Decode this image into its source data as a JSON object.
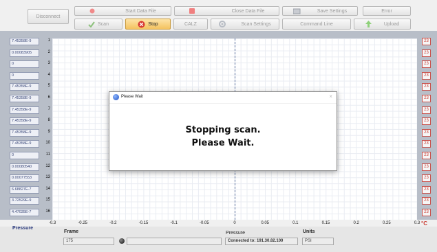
{
  "toolbar": {
    "disconnect": "Disconnect",
    "start_data_file": "Start Data File",
    "close_data_file": "Close Data File",
    "save_settings": "Save Settings",
    "error": "Error",
    "scan": "Scan",
    "stop": "Stop",
    "calz": "CALZ",
    "scan_settings": "Scan Settings",
    "command_line": "Command Line",
    "upload": "Upload"
  },
  "channels": [
    {
      "num": "1",
      "value": "7.45358E-9"
    },
    {
      "num": "2",
      "value": "0.00083905"
    },
    {
      "num": "3",
      "value": "0"
    },
    {
      "num": "4",
      "value": "0"
    },
    {
      "num": "5",
      "value": "7.45358E-9"
    },
    {
      "num": "6",
      "value": "7.45358E-9"
    },
    {
      "num": "7",
      "value": "7.45358E-9"
    },
    {
      "num": "8",
      "value": "7.45358E-9"
    },
    {
      "num": "9",
      "value": "7.45358E-9"
    },
    {
      "num": "10",
      "value": "7.45358E-9"
    },
    {
      "num": "11",
      "value": "0"
    },
    {
      "num": "12",
      "value": "0.00080540"
    },
    {
      "num": "13",
      "value": "0.00077553"
    },
    {
      "num": "14",
      "value": "6.68827E-7"
    },
    {
      "num": "15",
      "value": "3.72529E-9"
    },
    {
      "num": "16",
      "value": "4.47035E-7"
    }
  ],
  "temps": [
    "23",
    "23",
    "23",
    "23",
    "23",
    "23",
    "23",
    "23",
    "23",
    "23",
    "23",
    "23",
    "23",
    "23",
    "23",
    "23"
  ],
  "temp_unit": "°C",
  "x_ticks": [
    "-0.3",
    "-0.25",
    "-0.2",
    "-0.15",
    "-0.1",
    "-0.05",
    "0",
    "0.05",
    "0.1",
    "0.15",
    "0.2",
    "0.25",
    "0.3"
  ],
  "bottom": {
    "pressure_label": "Pressure",
    "frame_label": "Frame",
    "frame_value": "175",
    "pressure_field_label": "Pressure",
    "connection": "Connected to: 191.30.82.100",
    "units_label": "Units",
    "units_value": "PSI"
  },
  "dialog": {
    "title": "Please Wait",
    "close": "×",
    "line1": "Stopping scan.",
    "line2": "Please Wait."
  }
}
